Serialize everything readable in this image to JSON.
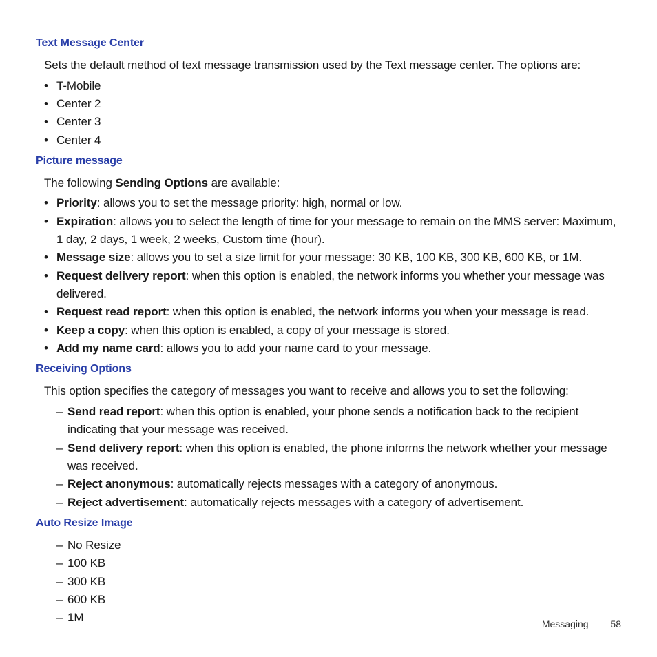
{
  "sections": {
    "tmc": {
      "heading": "Text Message Center",
      "intro": "Sets the default method of text message transmission used by the Text message center. The options are:",
      "items": [
        "T-Mobile",
        "Center 2",
        "Center 3",
        "Center 4"
      ]
    },
    "pm": {
      "heading": "Picture message",
      "intro_pre": "The following ",
      "intro_bold": "Sending Options",
      "intro_post": " are available:",
      "items": [
        {
          "term": "Priority",
          "desc": ": allows you to set the message priority: high, normal or low."
        },
        {
          "term": "Expiration",
          "desc": ": allows you to select the length of time for your message to remain on the MMS server: Maximum, 1 day, 2 days, 1 week, 2 weeks, Custom time (hour)."
        },
        {
          "term": "Message size",
          "desc": ": allows you to set a size limit for your message: 30 KB, 100 KB, 300 KB, 600 KB, or 1M."
        },
        {
          "term": "Request delivery report",
          "desc": ": when this option is enabled, the network informs you whether your message was delivered."
        },
        {
          "term": "Request read report",
          "desc": ": when this option is enabled, the network informs you when your message is read."
        },
        {
          "term": "Keep a copy",
          "desc": ": when this option is enabled, a copy of your message is stored."
        },
        {
          "term": "Add my name card",
          "desc": ": allows you to add your name card to your message."
        }
      ]
    },
    "ro": {
      "heading": "Receiving Options",
      "intro": "This option specifies the category of messages you want to receive and allows you to set the following:",
      "items": [
        {
          "term": "Send read report",
          "desc": ": when this option is enabled, your phone sends a notification back to the recipient indicating that your message was received."
        },
        {
          "term": "Send delivery report",
          "desc": ": when this option is enabled, the phone informs the network whether your message was received."
        },
        {
          "term": "Reject anonymous",
          "desc": ": automatically rejects messages with a category of anonymous."
        },
        {
          "term": "Reject advertisement",
          "desc": ": automatically rejects messages with a category of advertisement."
        }
      ]
    },
    "ari": {
      "heading": "Auto Resize Image",
      "items": [
        "No Resize",
        "100 KB",
        "300 KB",
        "600 KB",
        "1M"
      ]
    }
  },
  "footer": {
    "section": "Messaging",
    "page": "58"
  }
}
